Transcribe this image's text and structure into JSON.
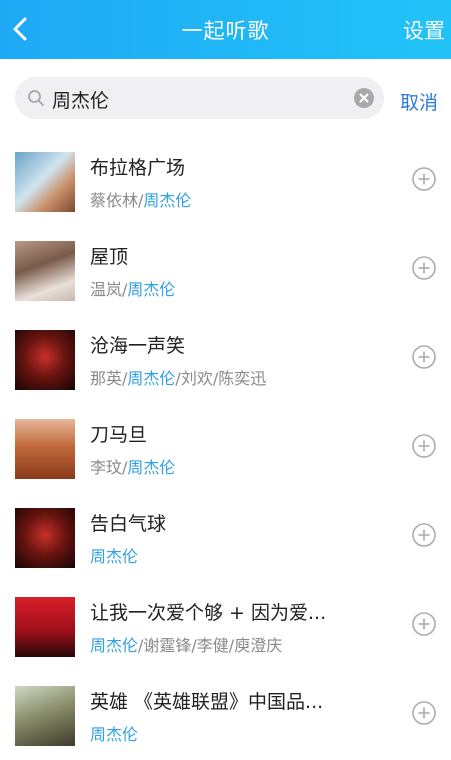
{
  "header": {
    "title": "一起听歌",
    "settings_label": "设置"
  },
  "search": {
    "query": "周杰伦",
    "cancel_label": "取消"
  },
  "colors": {
    "accent": "#22b5f7",
    "highlight": "#2fa2e6",
    "cancel": "#2f7ad6"
  },
  "songs": [
    {
      "title": "布拉格广场",
      "artists": [
        {
          "name": "蔡依林"
        },
        {
          "name": "/"
        },
        {
          "name": "周杰伦"
        }
      ]
    },
    {
      "title": "屋顶",
      "artists": [
        {
          "name": "温岚"
        },
        {
          "name": "/"
        },
        {
          "name": "周杰伦"
        }
      ]
    },
    {
      "title": "沧海一声笑",
      "artists": [
        {
          "name": "那英"
        },
        {
          "name": "/"
        },
        {
          "name": "周杰伦"
        },
        {
          "name": "/刘欢/陈奕迅"
        }
      ]
    },
    {
      "title": "刀马旦",
      "artists": [
        {
          "name": "李玟"
        },
        {
          "name": "/"
        },
        {
          "name": "周杰伦"
        }
      ]
    },
    {
      "title": "告白气球",
      "artists": [
        {
          "name": "周杰伦"
        }
      ]
    },
    {
      "title": "让我一次爱个够 + 因为爱...",
      "artists": [
        {
          "name": "周杰伦"
        },
        {
          "name": "/谢霆锋/李健/庾澄庆"
        }
      ]
    },
    {
      "title": "英雄 《英雄联盟》中国品...",
      "artists": [
        {
          "name": "周杰伦"
        }
      ]
    }
  ],
  "icons": {
    "back": "chevron-left-icon",
    "search": "search-icon",
    "clear": "clear-icon",
    "add": "add-circle-icon"
  }
}
